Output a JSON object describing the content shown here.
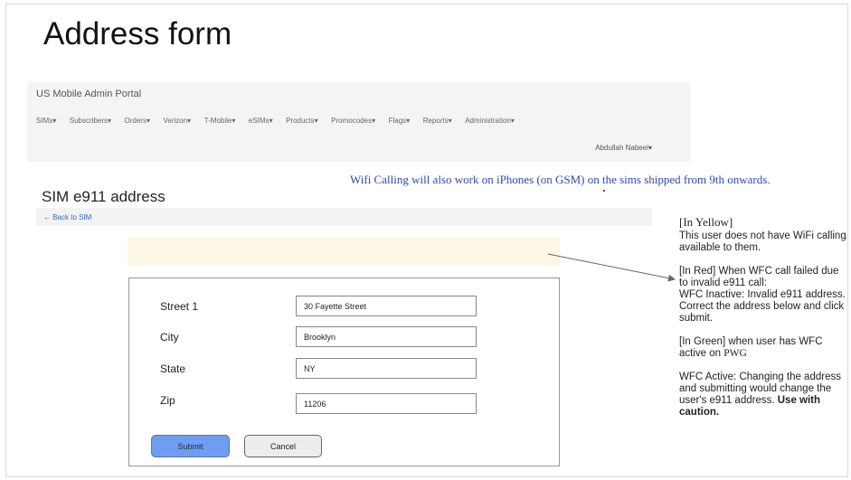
{
  "page": {
    "title": "Address form"
  },
  "portal": {
    "brand": "US Mobile Admin Portal",
    "menu": [
      {
        "label": "SIMs"
      },
      {
        "label": "Subscribers"
      },
      {
        "label": "Orders"
      },
      {
        "label": "Verizon"
      },
      {
        "label": "T-Mobile"
      },
      {
        "label": "eSIMs"
      },
      {
        "label": "Products"
      },
      {
        "label": "Promocodes"
      },
      {
        "label": "Flags"
      },
      {
        "label": "Reports"
      },
      {
        "label": "Administration"
      }
    ],
    "user": "Abdullah Nabeel"
  },
  "wifi_note": "Wifi Calling will also work on iPhones (on GSM) on the sims shipped from 9th onwards.",
  "section": {
    "title": "SIM e911 address",
    "back_link": "← Back to SIM"
  },
  "form": {
    "fields": [
      {
        "label": "Street 1",
        "value": "30 Fayette Street"
      },
      {
        "label": "City",
        "value": "Brooklyn"
      },
      {
        "label": "State",
        "value": "NY"
      },
      {
        "label": "Zip",
        "value": "11206"
      }
    ],
    "submit_label": "Submit",
    "cancel_label": "Cancel"
  },
  "notes": {
    "yellow_heading": "[In Yellow]",
    "yellow_text": "This user does not have WiFi calling available to them.",
    "red_text": "[In Red] When WFC call failed due to invalid e911 call:",
    "red_message": "WFC Inactive: Invalid e911 address. Correct the address below and click submit.",
    "green_text": "[In Green] when user has WFC active on",
    "green_carrier": "PWG",
    "active_text": "WFC Active: Changing the address and submitting would change the user's e911 address.",
    "caution": "Use with caution."
  },
  "colors": {
    "banner_yellow": "#fbf7e4",
    "submit_blue": "#6f9ef0",
    "note_blue": "#3344bb",
    "link_blue": "#3366cc"
  }
}
